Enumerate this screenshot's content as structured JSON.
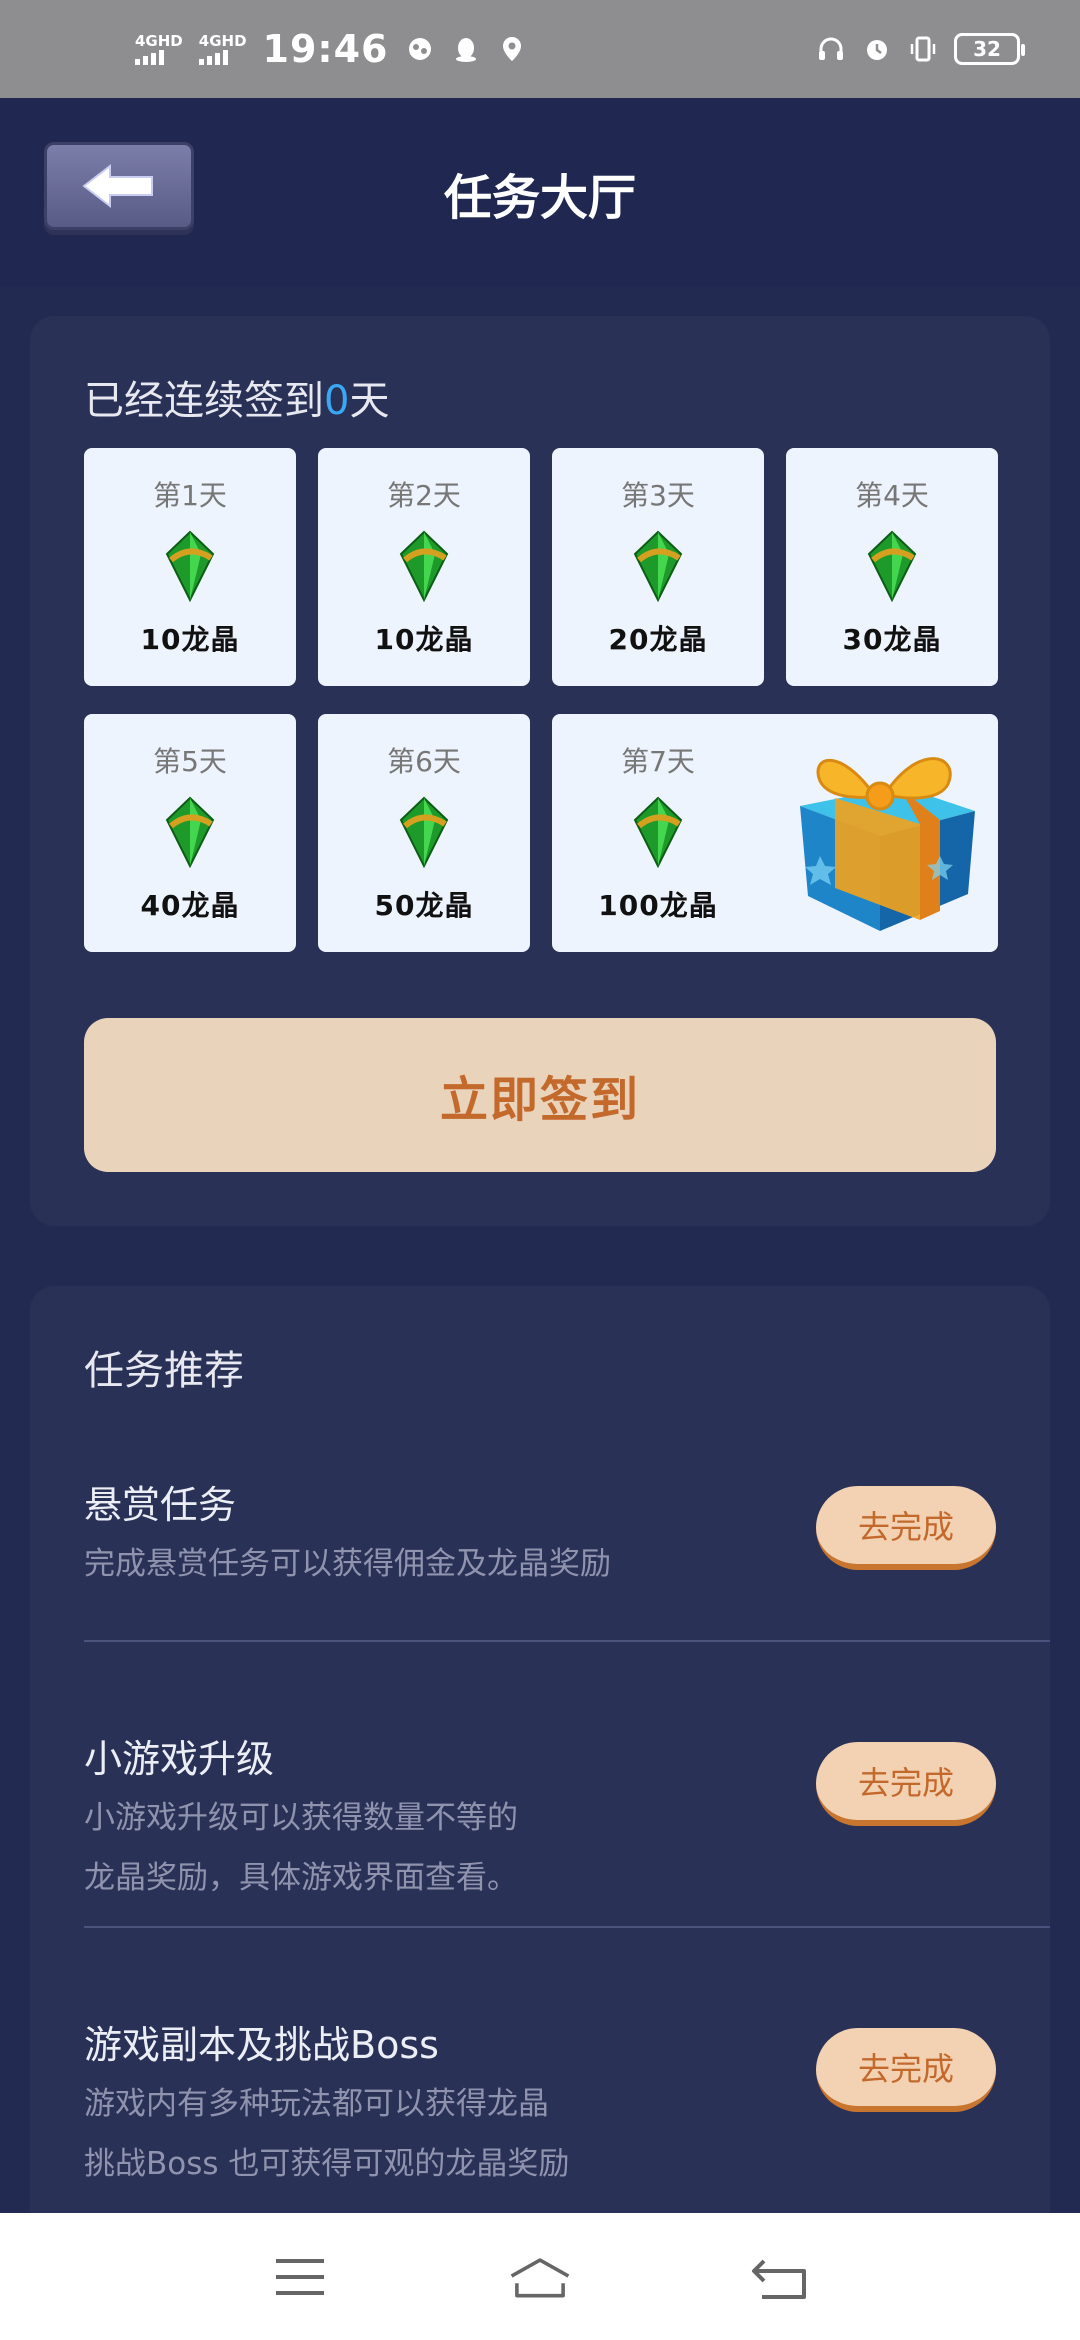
{
  "status_bar": {
    "network1": "4GHD",
    "network2": "4GHD",
    "time": "19:46",
    "battery": "32"
  },
  "header": {
    "title": "任务大厅"
  },
  "signin": {
    "streak_prefix": "已经连续签到",
    "streak_days": "0",
    "streak_suffix": "天",
    "days": [
      {
        "label": "第1天",
        "reward": "10龙晶"
      },
      {
        "label": "第2天",
        "reward": "10龙晶"
      },
      {
        "label": "第3天",
        "reward": "20龙晶"
      },
      {
        "label": "第4天",
        "reward": "30龙晶"
      },
      {
        "label": "第5天",
        "reward": "40龙晶"
      },
      {
        "label": "第6天",
        "reward": "50龙晶"
      },
      {
        "label": "第7天",
        "reward": "100龙晶"
      }
    ],
    "button_label": "立即签到"
  },
  "tasks": {
    "title": "任务推荐",
    "items": [
      {
        "name": "悬赏任务",
        "desc1": "完成悬赏任务可以获得佣金及龙晶奖励",
        "desc2": "",
        "button": "去完成"
      },
      {
        "name": "小游戏升级",
        "desc1": "小游戏升级可以获得数量不等的",
        "desc2": "龙晶奖励，具体游戏界面查看。",
        "button": "去完成"
      },
      {
        "name": "游戏副本及挑战Boss",
        "desc1": "游戏内有多种玩法都可以获得龙晶",
        "desc2": "挑战Boss 也可获得可观的龙晶奖励",
        "button": "去完成"
      }
    ]
  },
  "colors": {
    "background": "#222a52",
    "card": "#2a3157",
    "accent_blue": "#3aa9f5",
    "button_bg": "#ead3bb",
    "button_text": "#c4692c"
  }
}
